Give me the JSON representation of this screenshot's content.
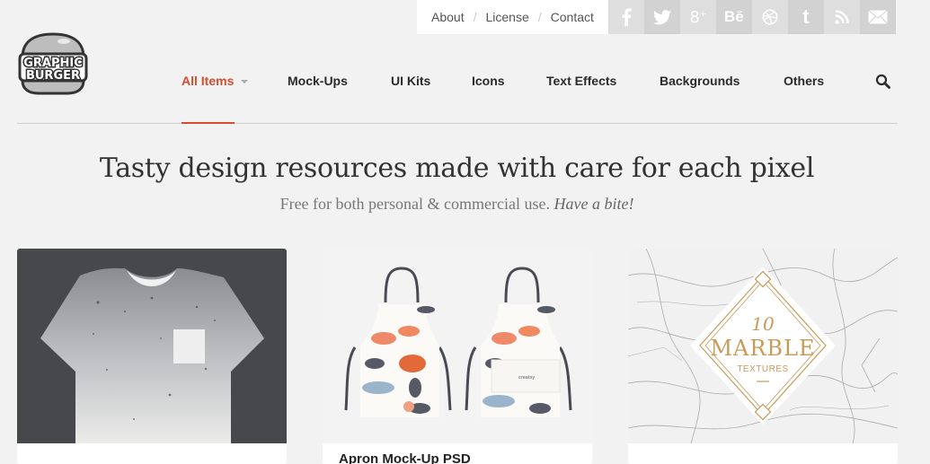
{
  "top_links": [
    "About",
    "License",
    "Contact"
  ],
  "social": [
    {
      "icon": "facebook-icon",
      "glyph": "f"
    },
    {
      "icon": "twitter-icon",
      "glyph": "🐦"
    },
    {
      "icon": "google-plus-icon",
      "glyph": "g+"
    },
    {
      "icon": "behance-icon",
      "glyph": "Bē"
    },
    {
      "icon": "dribbble-icon",
      "glyph": "⊛"
    },
    {
      "icon": "tumblr-icon",
      "glyph": "t"
    },
    {
      "icon": "rss-icon",
      "glyph": "rss"
    },
    {
      "icon": "mail-icon",
      "glyph": "✉"
    }
  ],
  "logo": {
    "line1": "GRAPHIC",
    "line2": "BURGER"
  },
  "nav": {
    "items": [
      "All Items",
      "Mock-Ups",
      "UI Kits",
      "Icons",
      "Text Effects",
      "Backgrounds",
      "Others"
    ],
    "active_index": 0,
    "accent_color": "#d64b30"
  },
  "hero": {
    "title": "Tasty design resources made with care for each pixel",
    "subtitle": "Free for both personal & commercial use.",
    "subtitle_em": "Have a bite!"
  },
  "cards": [
    {
      "title": "",
      "image": "gray speckled t-shirt mockup on dark background"
    },
    {
      "title": "Apron Mock-Up PSD",
      "image": "two aprons with seafood watercolor print",
      "apron_brand": "creatsy"
    },
    {
      "title": "",
      "image": "white marble texture",
      "badge": {
        "number": "10",
        "word": "MARBLE",
        "sub": "TEXTURES"
      }
    }
  ]
}
